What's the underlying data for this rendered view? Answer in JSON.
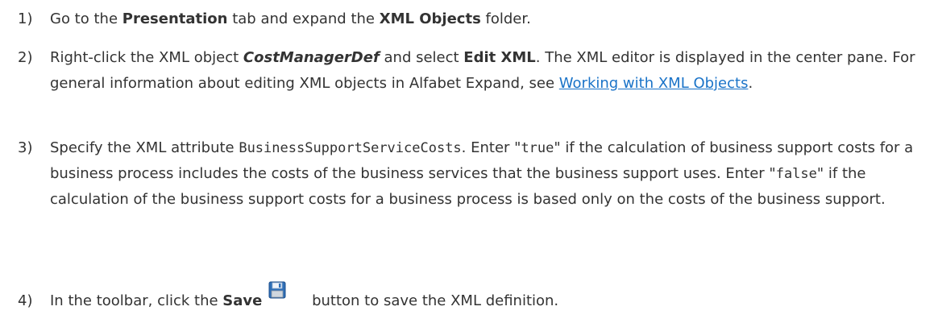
{
  "steps": [
    {
      "num": "1)",
      "p1": "Go to the ",
      "b1": "Presentation",
      "p2": " tab and expand the ",
      "b2": "XML Objects",
      "p3": " folder."
    },
    {
      "num": "2)",
      "p1": "Right-click the XML object ",
      "bi1": "CostManagerDef",
      "p2": " and select ",
      "b1": "Edit XML",
      "p3": ". The XML editor is displayed in the center pane. For general information about editing XML objects in Alfabet Expand, see ",
      "link": "Working with XML Objects",
      "p4": "."
    },
    {
      "num": "3)",
      "p1": "Specify the XML attribute ",
      "c1": "BusinessSupportServiceCosts",
      "p2": ". Enter \"",
      "c2": "true",
      "p3": "\" if the calculation of business support costs for a business process includes the costs of the business services that the business support uses. Enter \"",
      "c3": "false",
      "p4": "\" if the calculation of the business support costs for a business process is based only on the costs of the business support."
    },
    {
      "num": "4)",
      "p1": "In the toolbar, click the ",
      "b1": "Save",
      "icon": "save-floppy-icon",
      "p2": " button to save the XML definition."
    }
  ],
  "colors": {
    "text": "#333333",
    "link": "#1a73c8",
    "icon_blue": "#2f6fb7"
  }
}
